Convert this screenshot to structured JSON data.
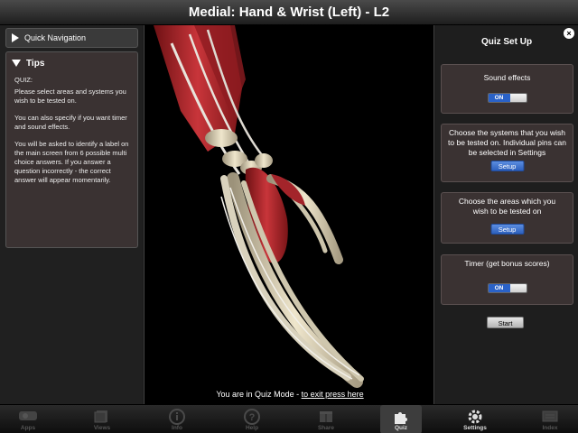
{
  "title": "Medial: Hand & Wrist (Left) - L2",
  "left": {
    "quick_nav_label": "Quick Navigation",
    "tips_label": "Tips",
    "tips_paragraphs": [
      "QUIZ:",
      "Please select areas and systems you wish to be tested on.",
      "You can also specify if you want timer and sound effects.",
      "You will be asked to identify a label on the main screen from 6 possible multi choice answers. If you answer a question incorrectly - the correct answer will appear momentarily."
    ]
  },
  "viewer": {
    "quiz_msg": "You are in Quiz Mode - ",
    "exit_link": "to exit press here"
  },
  "quiz_setup": {
    "title": "Quiz Set Up",
    "close_icon": "×",
    "sound_label": "Sound effects",
    "sound_toggle": "ON",
    "systems_text": "Choose the systems that you wish to be tested on. Individual pins can be selected in Settings",
    "systems_button": "Setup",
    "areas_text": "Choose the areas which you wish to be tested on",
    "areas_button": "Setup",
    "timer_label": "Timer (get bonus scores)",
    "timer_toggle": "ON",
    "start_button": "Start"
  },
  "tabs": [
    {
      "label": "Apps",
      "icon": "apps-icon"
    },
    {
      "label": "Views",
      "icon": "views-icon"
    },
    {
      "label": "Info",
      "icon": "info-icon"
    },
    {
      "label": "Help",
      "icon": "help-icon"
    },
    {
      "label": "Share",
      "icon": "share-icon"
    },
    {
      "label": "Quiz",
      "icon": "puzzle-icon",
      "active": true
    },
    {
      "label": "Settings",
      "icon": "gear-icon"
    },
    {
      "label": "Index",
      "icon": "index-icon"
    }
  ],
  "colors": {
    "accent_blue": "#2d60bd",
    "panel": "#3a3232",
    "muscle": "#b5252b",
    "bone": "#e6dcc0"
  }
}
